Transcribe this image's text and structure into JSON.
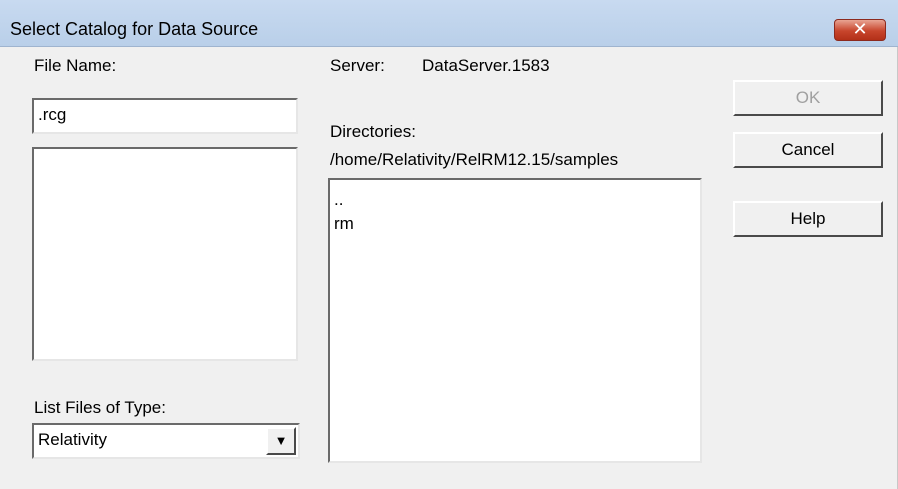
{
  "window": {
    "title": "Select Catalog for Data Source",
    "close_icon": "close-icon",
    "close_glyph": "✕"
  },
  "file_name": {
    "label": "File Name:",
    "value": ".rcg"
  },
  "files_list": {
    "items": []
  },
  "file_type": {
    "label": "List Files of Type:",
    "selected": "Relativity",
    "arrow_icon": "chevron-down-icon",
    "arrow_glyph": "▼"
  },
  "server": {
    "label": "Server:",
    "value": "DataServer.1583"
  },
  "directories": {
    "label": "Directories:",
    "path": "/home/Relativity/RelRM12.15/samples",
    "items": [
      "..",
      "rm"
    ]
  },
  "buttons": {
    "ok": "OK",
    "cancel": "Cancel",
    "help": "Help"
  }
}
